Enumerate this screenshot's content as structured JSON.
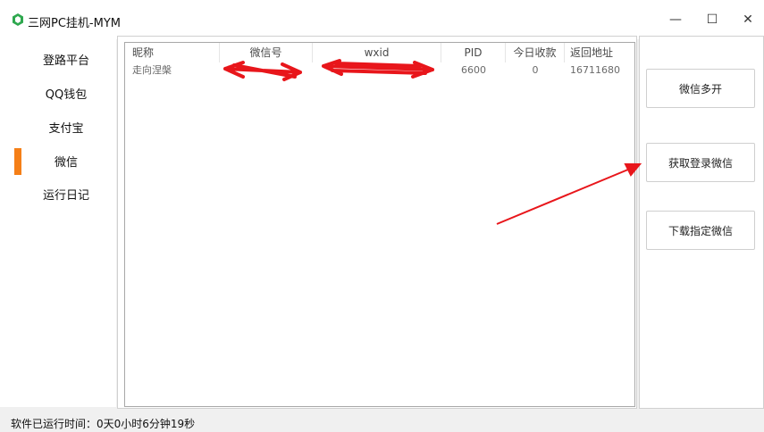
{
  "window": {
    "title": "三网PC挂机-MYM",
    "minimize_glyph": "—",
    "maximize_glyph": "☐",
    "close_glyph": "✕"
  },
  "sidebar": {
    "items": [
      {
        "label": "登路平台"
      },
      {
        "label": "QQ钱包"
      },
      {
        "label": "支付宝"
      },
      {
        "label": "微信"
      },
      {
        "label": "运行日记"
      }
    ],
    "active_index": 3,
    "active_color": "#f57f17"
  },
  "table": {
    "columns": [
      "昵称",
      "微信号",
      "wxid",
      "PID",
      "今日收款",
      "返回地址"
    ],
    "rows": [
      {
        "nickname": "走向涅槃",
        "wechat_id": "",
        "wxid": "",
        "pid": "6600",
        "today_income": "0",
        "return_addr": "16711680"
      }
    ]
  },
  "actions": {
    "multi_open": "微信多开",
    "get_login": "获取登录微信",
    "download_specific": "下载指定微信"
  },
  "status": {
    "runtime_text": "软件已运行时间：0天0小时6分钟19秒"
  },
  "annotations": {
    "color": "#e8161b"
  }
}
